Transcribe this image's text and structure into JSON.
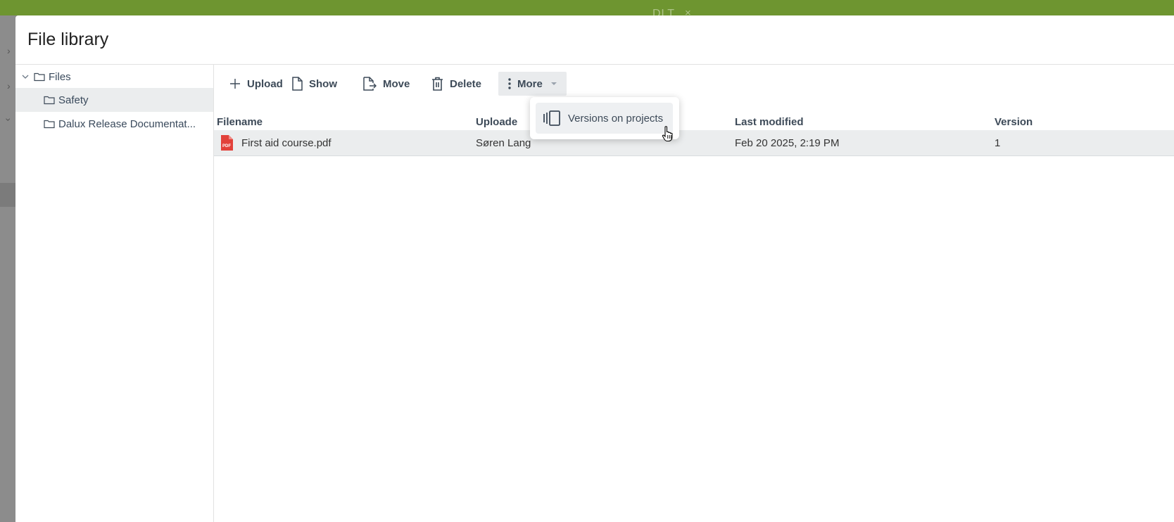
{
  "background": {
    "tab_label": "DLT",
    "tab_close": "×",
    "left_chevrons": [
      "›",
      "›",
      "›"
    ]
  },
  "dialog": {
    "title": "File library"
  },
  "tree": {
    "root": "Files",
    "children": [
      "Safety",
      "Dalux Release Documentat..."
    ],
    "selected": "Safety"
  },
  "toolbar": {
    "upload": "Upload",
    "show": "Show",
    "move": "Move",
    "delete": "Delete",
    "more": "More"
  },
  "table": {
    "headers": [
      "Filename",
      "Uploade",
      "Last modified",
      "Version"
    ],
    "rows": [
      {
        "filename": "First aid course.pdf",
        "uploader": "Søren Lang",
        "modified": "Feb 20 2025, 2:19 PM",
        "version": "1",
        "icon": "pdf-icon"
      }
    ]
  },
  "more_menu": {
    "items": [
      "Versions on projects"
    ]
  },
  "colors": {
    "topbar": "#6e9530",
    "selected_bg": "#ebedee",
    "pdf_red": "#e2413a",
    "text": "#3d4a58"
  }
}
